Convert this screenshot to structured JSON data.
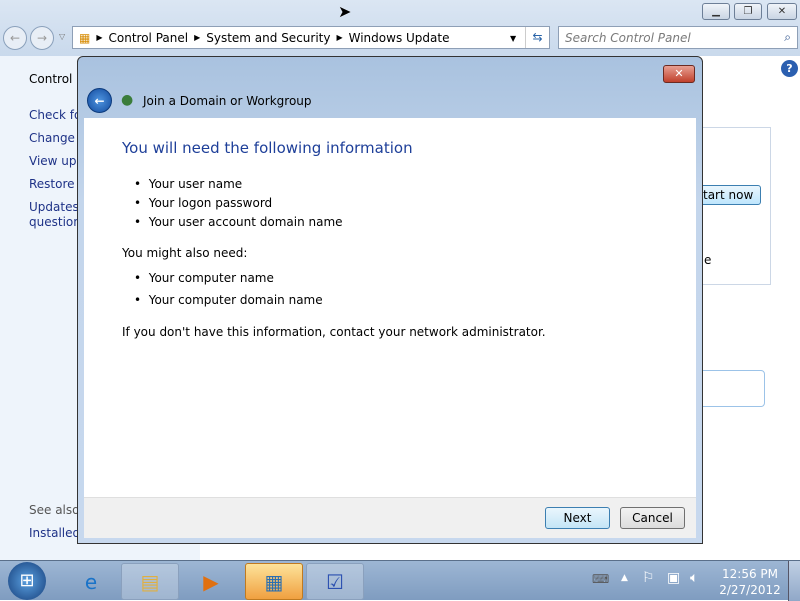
{
  "explorer": {
    "breadcrumb": [
      "Control Panel",
      "System and Security",
      "Windows Update"
    ],
    "search_placeholder": "Search Control Panel",
    "sidebar": {
      "items": [
        "Control P",
        "Check fo",
        "Change s",
        "View upd",
        "Restore h",
        "Updates:",
        "question"
      ],
      "see_also": "See also",
      "installed": "Installed"
    },
    "behind": {
      "start_now": "tart now",
      "e": "e"
    }
  },
  "dialog": {
    "title": "Join a Domain or Workgroup",
    "heading": "You will need the following information",
    "required": [
      "Your user name",
      "Your logon password",
      "Your user account domain name"
    ],
    "might_label": "You might also need:",
    "optional": [
      "Your computer name",
      "Your computer domain name"
    ],
    "note": "If you don't have this information, contact your network administrator.",
    "next": "Next",
    "cancel": "Cancel"
  },
  "taskbar": {
    "time": "12:56 PM",
    "date": "2/27/2012"
  },
  "colors": {
    "heading": "#1e3f99",
    "accent": "#3c7fb1"
  }
}
